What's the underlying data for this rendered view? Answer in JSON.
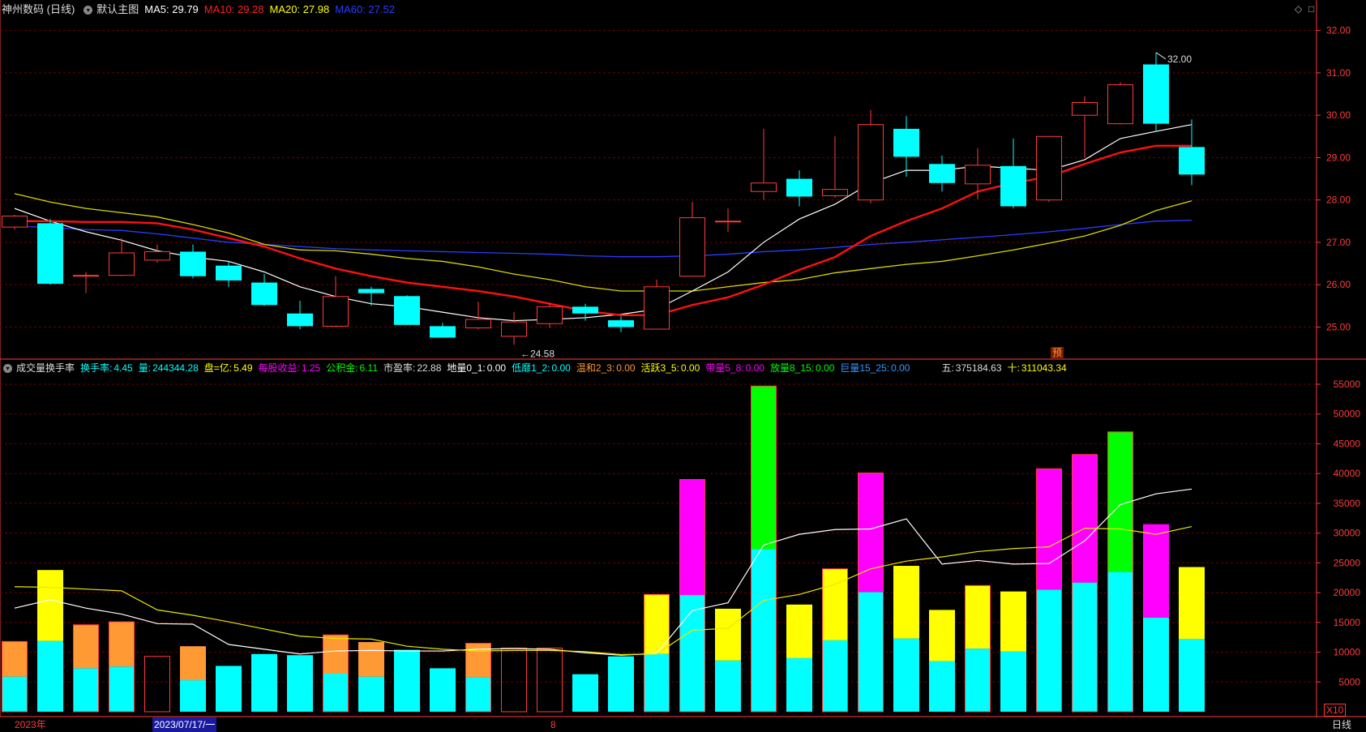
{
  "main": {
    "title": "神州数码 (日线)",
    "template": "默认主图",
    "ma": [
      {
        "label": "MA5: 29.79",
        "color": "#ffffff"
      },
      {
        "label": "MA10: 29.28",
        "color": "#ff2020"
      },
      {
        "label": "MA20: 27.98",
        "color": "#ffff00"
      },
      {
        "label": "MA60: 27.52",
        "color": "#2a3cff"
      }
    ],
    "high_label": "32.00",
    "low_label": "24.58",
    "marker": "预"
  },
  "sub": {
    "name": "成交量换手率",
    "fields": [
      {
        "k": "换手率:",
        "v": "4.45",
        "color": "#00ffff"
      },
      {
        "k": "量:",
        "v": "244344.28",
        "color": "#00ffff"
      },
      {
        "k": "盘=亿:",
        "v": "5.49",
        "color": "#ffff00"
      },
      {
        "k": "每股收益:",
        "v": "1.25",
        "color": "#ff00ff"
      },
      {
        "k": "公积金:",
        "v": "6.11",
        "color": "#00ff00"
      },
      {
        "k": "市盈率:",
        "v": "22.88",
        "color": "#dddddd"
      },
      {
        "k": "地量0_1:",
        "v": "0.00",
        "color": "#ffffff"
      },
      {
        "k": "低靡1_2:",
        "v": "0.00",
        "color": "#00ffff"
      },
      {
        "k": "温和2_3:",
        "v": "0.00",
        "color": "#ff9933"
      },
      {
        "k": "活跃3_5:",
        "v": "0.00",
        "color": "#ffff00"
      },
      {
        "k": "带量5_8:",
        "v": "0.00",
        "color": "#ff00ff"
      },
      {
        "k": "放量8_15:",
        "v": "0.00",
        "color": "#00ff00"
      },
      {
        "k": "巨量15_25:",
        "v": "0.00",
        "color": "#3399ff"
      }
    ],
    "five": {
      "k": "五:",
      "v": "375184.63",
      "color": "#dddddd"
    },
    "ten": {
      "k": "十:",
      "v": "311043.34",
      "color": "#ffff00"
    },
    "multiplier": "X10"
  },
  "xaxis": {
    "year": "2023年",
    "cursor": "2023/07/17/一",
    "month": "8",
    "period": "日线"
  },
  "chart_data": [
    {
      "type": "candlestick",
      "ylim": [
        24.3,
        32.3
      ],
      "yticks": [
        25,
        26,
        27,
        28,
        29,
        30,
        31,
        32
      ],
      "candles": [
        {
          "o": 27.36,
          "h": 27.65,
          "l": 27.3,
          "c": 27.62
        },
        {
          "o": 27.45,
          "h": 27.55,
          "l": 26.0,
          "c": 26.02
        },
        {
          "o": 26.22,
          "h": 26.3,
          "l": 25.8,
          "c": 26.22
        },
        {
          "o": 26.22,
          "h": 27.1,
          "l": 26.2,
          "c": 26.75
        },
        {
          "o": 26.58,
          "h": 26.95,
          "l": 26.52,
          "c": 26.78
        },
        {
          "o": 26.78,
          "h": 26.95,
          "l": 26.15,
          "c": 26.2
        },
        {
          "o": 26.45,
          "h": 26.55,
          "l": 25.95,
          "c": 26.1
        },
        {
          "o": 26.05,
          "h": 26.25,
          "l": 25.5,
          "c": 25.52
        },
        {
          "o": 25.32,
          "h": 25.62,
          "l": 24.95,
          "c": 25.02
        },
        {
          "o": 25.02,
          "h": 26.2,
          "l": 25.0,
          "c": 25.72
        },
        {
          "o": 25.9,
          "h": 25.95,
          "l": 25.5,
          "c": 25.8
        },
        {
          "o": 25.73,
          "h": 25.75,
          "l": 25.05,
          "c": 25.05
        },
        {
          "o": 25.02,
          "h": 25.1,
          "l": 24.75,
          "c": 24.75
        },
        {
          "o": 24.98,
          "h": 25.6,
          "l": 24.95,
          "c": 25.18
        },
        {
          "o": 24.78,
          "h": 25.35,
          "l": 24.58,
          "c": 25.12
        },
        {
          "o": 25.08,
          "h": 25.58,
          "l": 24.98,
          "c": 25.48
        },
        {
          "o": 25.48,
          "h": 25.55,
          "l": 25.15,
          "c": 25.32
        },
        {
          "o": 25.16,
          "h": 25.25,
          "l": 24.88,
          "c": 25.0
        },
        {
          "o": 24.95,
          "h": 26.12,
          "l": 24.95,
          "c": 25.95
        },
        {
          "o": 26.2,
          "h": 27.95,
          "l": 26.2,
          "c": 27.58
        },
        {
          "o": 27.5,
          "h": 27.8,
          "l": 27.25,
          "c": 27.5
        },
        {
          "o": 28.2,
          "h": 29.68,
          "l": 28.0,
          "c": 28.4
        },
        {
          "o": 28.5,
          "h": 28.7,
          "l": 27.85,
          "c": 28.08
        },
        {
          "o": 28.1,
          "h": 29.5,
          "l": 28.05,
          "c": 28.25
        },
        {
          "o": 28.0,
          "h": 30.12,
          "l": 27.92,
          "c": 29.78
        },
        {
          "o": 29.68,
          "h": 29.98,
          "l": 28.55,
          "c": 29.02
        },
        {
          "o": 28.85,
          "h": 29.05,
          "l": 28.2,
          "c": 28.4
        },
        {
          "o": 28.38,
          "h": 29.22,
          "l": 28.02,
          "c": 28.82
        },
        {
          "o": 28.8,
          "h": 29.45,
          "l": 27.8,
          "c": 27.85
        },
        {
          "o": 28.0,
          "h": 29.48,
          "l": 27.95,
          "c": 29.5
        },
        {
          "o": 30.0,
          "h": 30.45,
          "l": 29.0,
          "c": 30.3
        },
        {
          "o": 29.8,
          "h": 30.78,
          "l": 29.78,
          "c": 30.72
        },
        {
          "o": 31.2,
          "h": 31.48,
          "l": 29.62,
          "c": 29.8
        },
        {
          "o": 29.25,
          "h": 29.9,
          "l": 28.35,
          "c": 28.6
        }
      ],
      "ma5": [
        27.8,
        27.5,
        27.25,
        27.05,
        26.8,
        26.65,
        26.55,
        26.3,
        25.95,
        25.72,
        25.55,
        25.48,
        25.35,
        25.22,
        25.15,
        25.18,
        25.22,
        25.3,
        25.42,
        25.85,
        26.3,
        27.0,
        27.55,
        27.9,
        28.4,
        28.7,
        28.7,
        28.8,
        28.75,
        28.7,
        28.95,
        29.45,
        29.62,
        29.78
      ],
      "ma10": [
        27.5,
        27.5,
        27.48,
        27.48,
        27.45,
        27.3,
        27.1,
        26.9,
        26.62,
        26.38,
        26.2,
        26.05,
        25.95,
        25.85,
        25.72,
        25.55,
        25.38,
        25.28,
        25.28,
        25.52,
        25.7,
        26.0,
        26.35,
        26.65,
        27.15,
        27.5,
        27.8,
        28.2,
        28.4,
        28.55,
        28.85,
        29.12,
        29.28,
        29.28
      ],
      "ma20": [
        28.15,
        27.95,
        27.8,
        27.7,
        27.6,
        27.42,
        27.22,
        26.95,
        26.82,
        26.8,
        26.72,
        26.62,
        26.55,
        26.42,
        26.25,
        26.12,
        25.95,
        25.85,
        25.85,
        25.85,
        25.95,
        26.05,
        26.12,
        26.28,
        26.38,
        26.48,
        26.55,
        26.68,
        26.82,
        26.98,
        27.15,
        27.4,
        27.75,
        27.98
      ],
      "ma60": [
        27.38,
        27.35,
        27.3,
        27.28,
        27.2,
        27.1,
        27.0,
        26.95,
        26.9,
        26.85,
        26.82,
        26.8,
        26.78,
        26.76,
        26.74,
        26.72,
        26.68,
        26.66,
        26.66,
        26.68,
        26.72,
        26.78,
        26.82,
        26.88,
        26.95,
        27.0,
        27.06,
        27.12,
        27.18,
        27.25,
        27.33,
        27.42,
        27.5,
        27.52
      ]
    },
    {
      "type": "bar",
      "ylim": [
        0,
        56500
      ],
      "yticks": [
        5000,
        10000,
        15000,
        20000,
        25000,
        30000,
        35000,
        40000,
        45000,
        50000,
        55000
      ],
      "volume": [
        11800,
        23800,
        14600,
        15100,
        9300,
        11000,
        7700,
        9700,
        9500,
        12900,
        11700,
        10400,
        7300,
        11500,
        10700,
        10700,
        6300,
        9300,
        19700,
        39000,
        17300,
        54700,
        18000,
        24000,
        40100,
        24500,
        17100,
        21200,
        20200,
        40800,
        43200,
        47000,
        31500,
        24300
      ],
      "split": [
        5900,
        11900,
        7300,
        7600,
        null,
        5300,
        null,
        null,
        null,
        6400,
        5900,
        null,
        null,
        5800,
        null,
        null,
        null,
        null,
        9700,
        19600,
        8600,
        27300,
        9000,
        12000,
        20100,
        12300,
        8500,
        10600,
        10100,
        20500,
        21700,
        23500,
        15800,
        12200
      ],
      "mav5": [
        17400,
        18800,
        17400,
        16400,
        14800,
        14700,
        11300,
        10500,
        9700,
        10200,
        10300,
        10200,
        10200,
        10500,
        10600,
        10500,
        9900,
        9500,
        9800,
        17000,
        18300,
        28000,
        29800,
        30600,
        30700,
        32400,
        24800,
        25400,
        24800,
        24900,
        28700,
        34800,
        36600,
        37400
      ],
      "mav10": [
        21000,
        20900,
        20600,
        20300,
        17100,
        16200,
        15100,
        13900,
        12700,
        12300,
        12200,
        11000,
        10500,
        10200,
        10300,
        10300,
        10100,
        9600,
        9700,
        13700,
        14000,
        18700,
        19700,
        21400,
        24000,
        25300,
        26000,
        26900,
        27400,
        27700,
        30800,
        30700,
        29800,
        31100
      ],
      "colors": [
        "#ff9933",
        "#ffff00",
        "#ff9933",
        "#ff9933",
        "none",
        "#ff9933",
        "#00ffff",
        "#00ffff",
        "#00ffff",
        "#ff9933",
        "#ff9933",
        "#00ffff",
        "#00ffff",
        "#ff9933",
        "none",
        "none",
        "#00ffff",
        "#00ffff",
        "#ffff00",
        "#ff00ff",
        "#ffff00",
        "#00ff00",
        "#ffff00",
        "#ffff00",
        "#ff00ff",
        "#ffff00",
        "#ffff00",
        "#ffff00",
        "#ffff00",
        "#ff00ff",
        "#ff00ff",
        "#00ff00",
        "#ff00ff",
        "#ffff00"
      ],
      "down": [
        false,
        true,
        false,
        false,
        false,
        true,
        true,
        true,
        true,
        false,
        true,
        true,
        true,
        false,
        false,
        false,
        true,
        true,
        false,
        false,
        true,
        false,
        true,
        false,
        false,
        true,
        true,
        false,
        true,
        false,
        false,
        false,
        true,
        true
      ]
    }
  ]
}
